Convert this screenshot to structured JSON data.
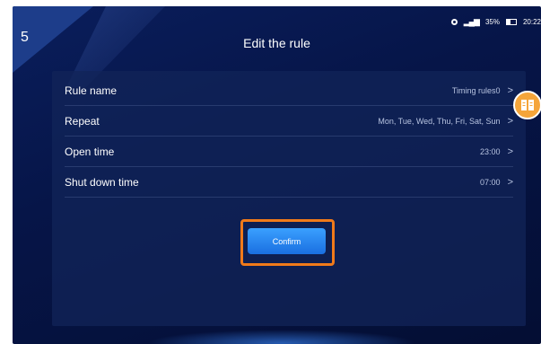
{
  "step_badge": "5",
  "status_bar": {
    "battery": "35%",
    "time": "20:22"
  },
  "header": {
    "title": "Edit the rule"
  },
  "rules": [
    {
      "label": "Rule name",
      "value": "Timing rules0"
    },
    {
      "label": "Repeat",
      "value": "Mon,  Tue,  Wed,  Thu,  Fri,  Sat,  Sun"
    },
    {
      "label": "Open time",
      "value": "23:00"
    },
    {
      "label": "Shut down time",
      "value": "07:00"
    }
  ],
  "confirm_label": "Confirm",
  "colors": {
    "accent_blue": "#1a6fe0",
    "highlight_orange": "#f07a1a",
    "float_button": "#f5a53a"
  },
  "icons": {
    "float_button": "book-icon"
  }
}
